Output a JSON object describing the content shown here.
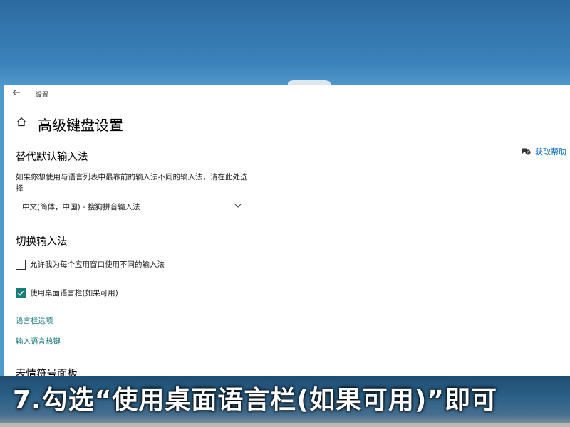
{
  "window": {
    "title": "设置",
    "page_title": "高级键盘设置"
  },
  "help": {
    "label": "获取帮助",
    "icon": "chat-help-icon"
  },
  "sections": {
    "default_ime": {
      "title": "替代默认输入法",
      "description": "如果你想使用与语言列表中最靠前的输入法不同的输入法，请在此处选择",
      "selected": "中文(简体，中国) - 搜狗拼音输入法"
    },
    "switch_ime": {
      "title": "切换输入法",
      "options": [
        {
          "label": "允许我为每个应用窗口使用不同的输入法",
          "checked": false
        },
        {
          "label": "使用桌面语言栏(如果可用)",
          "checked": true
        }
      ],
      "links": [
        "语言栏选项",
        "输入语言热键"
      ]
    },
    "emoji": {
      "title": "表情符号面板"
    }
  },
  "caption": "7.勾选“使用桌面语言栏(如果可用)”即可",
  "colors": {
    "accent": "#1a7d7a",
    "help_link": "#0067b8"
  }
}
